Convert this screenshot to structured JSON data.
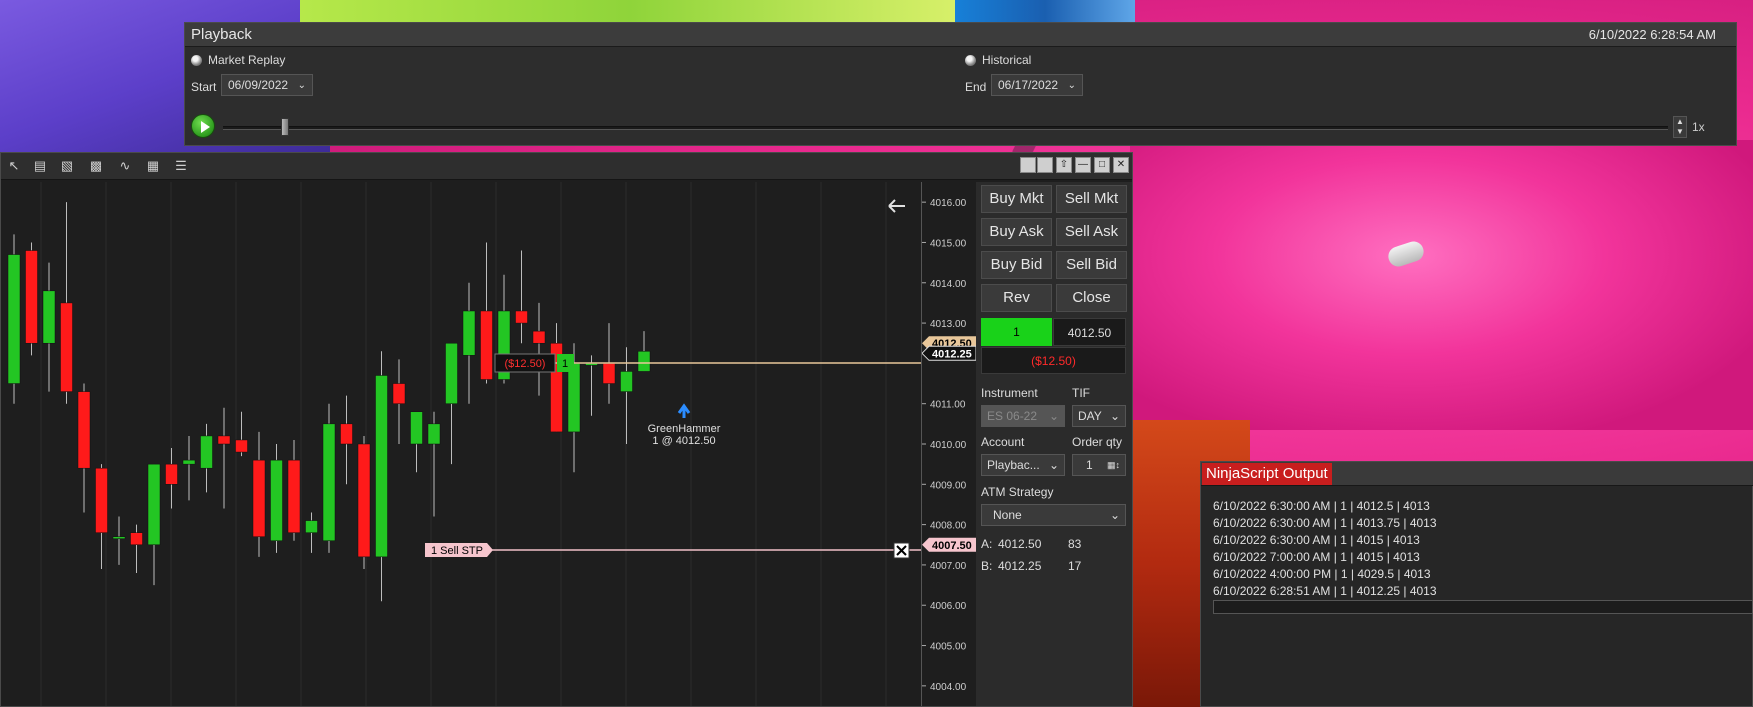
{
  "playback": {
    "title": "Playback",
    "timestamp": "6/10/2022 6:28:54 AM",
    "market_replay_label": "Market Replay",
    "historical_label": "Historical",
    "start_label": "Start",
    "start_date": "06/09/2022",
    "end_label": "End",
    "end_date": "06/17/2022",
    "speed": "1x",
    "position": 0.04
  },
  "chart": {
    "flag": "F",
    "price_ticks": [
      "4016.00",
      "4015.00",
      "4014.00",
      "4013.00",
      "4012.50",
      "4012.25",
      "4011.00",
      "4010.00",
      "4009.00",
      "4008.00",
      "4007.50",
      "4007.00",
      "4006.00",
      "4005.00",
      "4004.00"
    ],
    "position_pnl": "($12.50)",
    "position_qty": "1",
    "stop_label": "1  Sell STP",
    "signal_name": "GreenHammer",
    "signal_fill": "1 @ 4012.50",
    "colors": {
      "up": "#23c623",
      "down": "#ff1a1a",
      "bg": "#1e1e1e"
    }
  },
  "chart_data": {
    "type": "candlestick",
    "ylim": [
      4003.5,
      4016.5
    ],
    "candles": [
      {
        "o": 4011.5,
        "h": 4015.2,
        "l": 4011.0,
        "c": 4014.7
      },
      {
        "o": 4014.8,
        "h": 4015.0,
        "l": 4012.2,
        "c": 4012.5
      },
      {
        "o": 4012.5,
        "h": 4014.5,
        "l": 4011.3,
        "c": 4013.8
      },
      {
        "o": 4013.5,
        "h": 4016.0,
        "l": 4011.0,
        "c": 4011.3
      },
      {
        "o": 4011.3,
        "h": 4011.5,
        "l": 4008.3,
        "c": 4009.4
      },
      {
        "o": 4009.4,
        "h": 4009.5,
        "l": 4006.9,
        "c": 4007.8
      },
      {
        "o": 4007.7,
        "h": 4008.2,
        "l": 4007.0,
        "c": 4007.7
      },
      {
        "o": 4007.8,
        "h": 4008.0,
        "l": 4006.8,
        "c": 4007.5
      },
      {
        "o": 4007.5,
        "h": 4009.5,
        "l": 4006.5,
        "c": 4009.5
      },
      {
        "o": 4009.5,
        "h": 4009.9,
        "l": 4008.4,
        "c": 4009.0
      },
      {
        "o": 4009.5,
        "h": 4010.2,
        "l": 4008.6,
        "c": 4009.6
      },
      {
        "o": 4009.4,
        "h": 4010.5,
        "l": 4008.8,
        "c": 4010.2
      },
      {
        "o": 4010.2,
        "h": 4010.9,
        "l": 4008.4,
        "c": 4010.0
      },
      {
        "o": 4010.1,
        "h": 4010.8,
        "l": 4009.7,
        "c": 4009.8
      },
      {
        "o": 4009.6,
        "h": 4010.3,
        "l": 4007.2,
        "c": 4007.7
      },
      {
        "o": 4007.6,
        "h": 4010.0,
        "l": 4007.3,
        "c": 4009.6
      },
      {
        "o": 4009.6,
        "h": 4010.1,
        "l": 4007.6,
        "c": 4007.8
      },
      {
        "o": 4007.8,
        "h": 4008.3,
        "l": 4007.3,
        "c": 4008.1
      },
      {
        "o": 4007.6,
        "h": 4011.0,
        "l": 4007.3,
        "c": 4010.5
      },
      {
        "o": 4010.5,
        "h": 4011.2,
        "l": 4009.0,
        "c": 4010.0
      },
      {
        "o": 4010.0,
        "h": 4010.2,
        "l": 4006.9,
        "c": 4007.2
      },
      {
        "o": 4007.2,
        "h": 4012.3,
        "l": 4006.1,
        "c": 4011.7
      },
      {
        "o": 4011.5,
        "h": 4012.1,
        "l": 4010.0,
        "c": 4011.0
      },
      {
        "o": 4010.0,
        "h": 4010.8,
        "l": 4009.3,
        "c": 4010.8
      },
      {
        "o": 4010.0,
        "h": 4010.8,
        "l": 4008.2,
        "c": 4010.5
      },
      {
        "o": 4011.0,
        "h": 4012.5,
        "l": 4009.5,
        "c": 4012.5
      },
      {
        "o": 4012.2,
        "h": 4014.0,
        "l": 4011.0,
        "c": 4013.3
      },
      {
        "o": 4013.3,
        "h": 4015.0,
        "l": 4011.5,
        "c": 4011.6
      },
      {
        "o": 4011.6,
        "h": 4014.2,
        "l": 4011.5,
        "c": 4013.3
      },
      {
        "o": 4013.3,
        "h": 4014.8,
        "l": 4012.5,
        "c": 4013.0
      },
      {
        "o": 4012.8,
        "h": 4013.5,
        "l": 4011.2,
        "c": 4012.5
      },
      {
        "o": 4012.5,
        "h": 4013.0,
        "l": 4010.3,
        "c": 4010.3
      },
      {
        "o": 4010.3,
        "h": 4012.5,
        "l": 4009.3,
        "c": 4012.0
      },
      {
        "o": 4012.0,
        "h": 4012.2,
        "l": 4010.7,
        "c": 4012.0
      },
      {
        "o": 4012.0,
        "h": 4013.0,
        "l": 4011.0,
        "c": 4011.5
      },
      {
        "o": 4011.3,
        "h": 4012.4,
        "l": 4010.0,
        "c": 4011.8
      },
      {
        "o": 4011.8,
        "h": 4012.8,
        "l": 4011.8,
        "c": 4012.3
      }
    ]
  },
  "toolbar_icons": [
    "pointer-icon",
    "data-series-icon",
    "chart-style-icon",
    "indicators-icon",
    "drawing-tools-icon",
    "strategies-icon",
    "properties-icon"
  ],
  "order_entry": {
    "buy_mkt": "Buy Mkt",
    "sell_mkt": "Sell Mkt",
    "buy_ask": "Buy Ask",
    "sell_ask": "Sell Ask",
    "buy_bid": "Buy Bid",
    "sell_bid": "Sell Bid",
    "rev": "Rev",
    "close": "Close",
    "position_qty": "1",
    "position_price": "4012.50",
    "unrealized": "($12.50)",
    "instrument_label": "Instrument",
    "instrument": "ES 06-22",
    "tif_label": "TIF",
    "tif": "DAY",
    "account_label": "Account",
    "account": "Playbac...",
    "order_qty_label": "Order qty",
    "order_qty": "1",
    "atm_label": "ATM Strategy",
    "atm": "None",
    "ask_label": "A:",
    "ask_price": "4012.50",
    "ask_size": "83",
    "bid_label": "B:",
    "bid_price": "4012.25",
    "bid_size": "17"
  },
  "ninjascript": {
    "title": "NinjaScript Output",
    "lines": [
      "6/10/2022 6:30:00 AM | 1 | 4012.5 | 4013",
      "6/10/2022 6:30:00 AM | 1 | 4013.75 | 4013",
      "6/10/2022 6:30:00 AM | 1 | 4015 | 4013",
      "6/10/2022 7:00:00 AM | 1 | 4015 | 4013",
      "6/10/2022 4:00:00 PM | 1 | 4029.5 | 4013",
      "6/10/2022 6:28:51 AM | 1 | 4012.25 | 4013"
    ]
  }
}
